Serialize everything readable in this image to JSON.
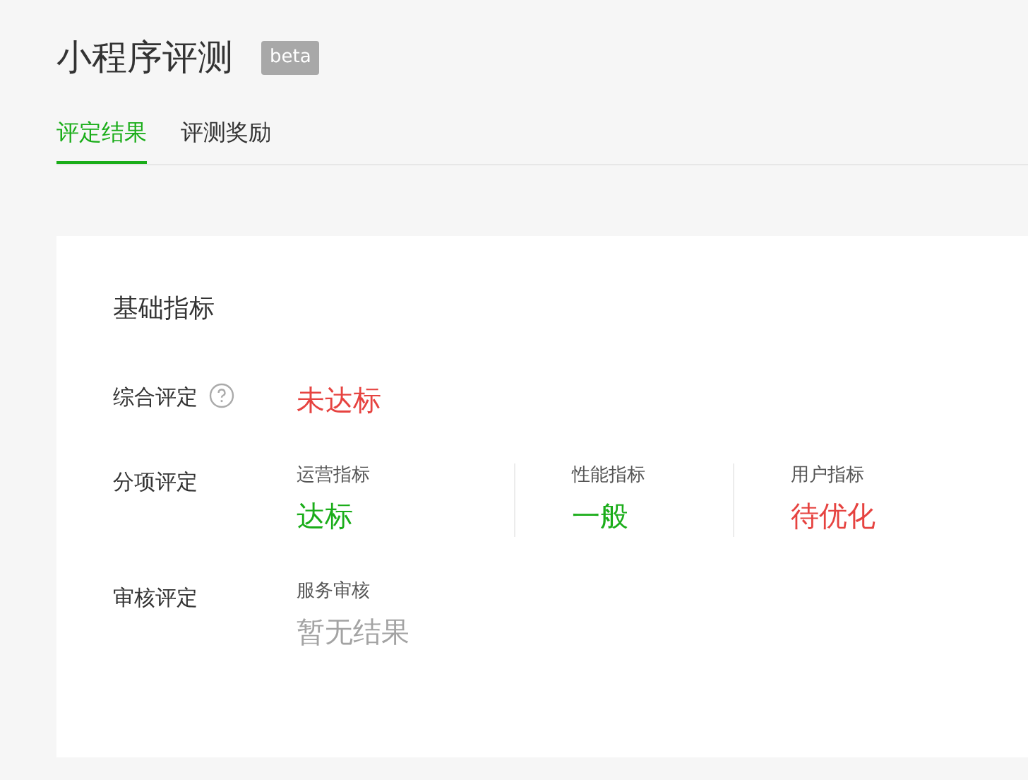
{
  "header": {
    "title": "小程序评测",
    "badge": "beta"
  },
  "tabs": [
    {
      "label": "评定结果",
      "selected": true
    },
    {
      "label": "评测奖励",
      "selected": false
    }
  ],
  "card": {
    "title": "基础指标",
    "rows": [
      {
        "kind": "single",
        "label": "综合评定",
        "help": true,
        "value": "未达标",
        "color": "#e64340"
      },
      {
        "kind": "metrics",
        "label": "分项评定",
        "items": [
          {
            "label": "运营指标",
            "value": "达标",
            "color": "#1aad19"
          },
          {
            "label": "性能指标",
            "value": "一般",
            "color": "#1aad19"
          },
          {
            "label": "用户指标",
            "value": "待优化",
            "color": "#e64340"
          }
        ]
      },
      {
        "kind": "metrics",
        "label": "审核评定",
        "items": [
          {
            "label": "服务审核",
            "value": "暂无结果",
            "color": "#a3a3a3"
          }
        ]
      }
    ]
  }
}
